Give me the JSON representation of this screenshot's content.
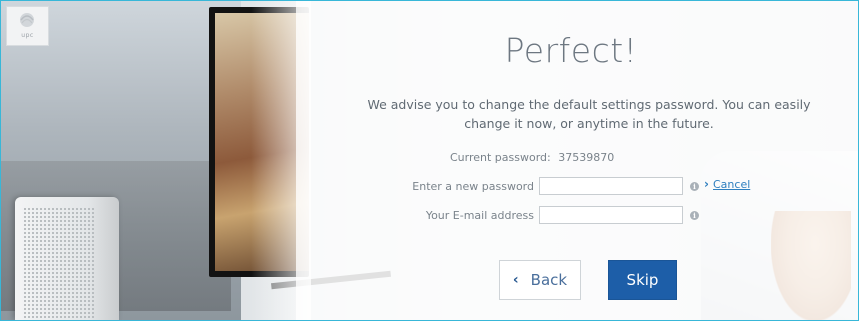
{
  "logo": {
    "text": "upc"
  },
  "page": {
    "title": "Perfect!",
    "message": "We advise you to change the default settings password. You can easily change it now, or anytime in the future."
  },
  "form": {
    "current_password_label": "Current password:",
    "current_password_value": "37539870",
    "new_password_label": "Enter a new password",
    "new_password_value": "",
    "email_label": "Your E-mail address",
    "email_value": "",
    "cancel_label": "Cancel"
  },
  "buttons": {
    "back_label": "Back",
    "skip_label": "Skip"
  },
  "colors": {
    "frame_border": "#38b7d8",
    "primary": "#1d5ea8",
    "link": "#2f7fbf",
    "title_text": "#6d7781"
  },
  "icons": [
    "info-icon",
    "chevron-right-icon",
    "chevron-left-icon",
    "upc-logo-icon"
  ]
}
